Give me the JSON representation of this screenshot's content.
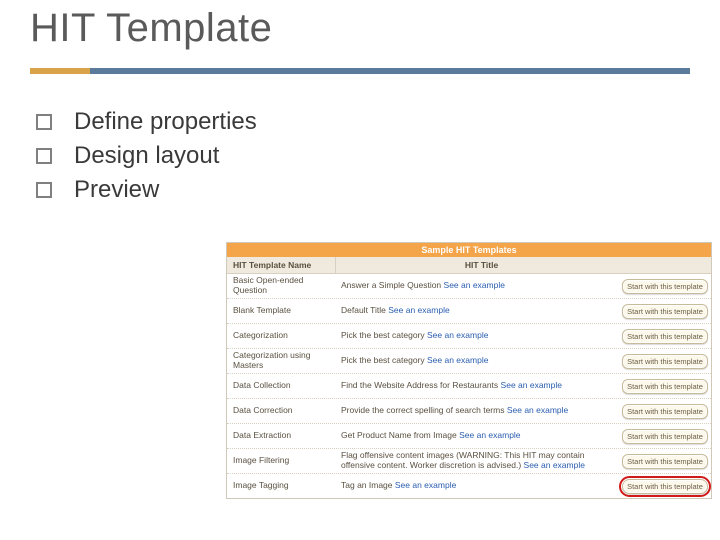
{
  "title": "HIT Template",
  "bullets": [
    "Define properties",
    "Design layout",
    "Preview"
  ],
  "panel": {
    "header": "Sample HIT Templates",
    "columns": [
      "HIT Template Name",
      "HIT Title"
    ],
    "link_text": "See an example",
    "button_label": "Start with this template",
    "rows": [
      {
        "name": "Basic Open-ended Question",
        "title_prefix": "Answer a Simple Question",
        "highlight": false
      },
      {
        "name": "Blank Template",
        "title_prefix": "Default Title",
        "highlight": false
      },
      {
        "name": "Categorization",
        "title_prefix": "Pick the best category",
        "highlight": false
      },
      {
        "name": "Categorization using Masters",
        "title_prefix": "Pick the best category",
        "highlight": false
      },
      {
        "name": "Data Collection",
        "title_prefix": "Find the Website Address for Restaurants",
        "highlight": false
      },
      {
        "name": "Data Correction",
        "title_prefix": "Provide the correct spelling of search terms",
        "highlight": false
      },
      {
        "name": "Data Extraction",
        "title_prefix": "Get Product Name from Image",
        "highlight": false
      },
      {
        "name": "Image Filtering",
        "title_prefix": "Flag offensive content images (WARNING: This HIT may contain offensive content. Worker discretion is advised.)",
        "highlight": false
      },
      {
        "name": "Image Tagging",
        "title_prefix": "Tag an Image",
        "highlight": true
      }
    ]
  }
}
